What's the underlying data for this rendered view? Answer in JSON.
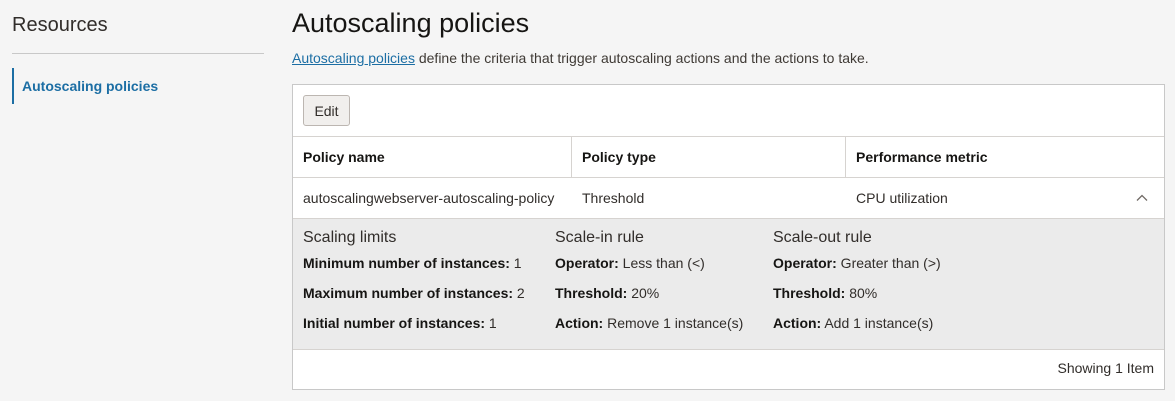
{
  "sidebar": {
    "title": "Resources",
    "items": [
      {
        "label": "Autoscaling policies"
      }
    ]
  },
  "page": {
    "title": "Autoscaling policies",
    "description_link": "Autoscaling policies",
    "description_rest": " define the criteria that trigger autoscaling actions and the actions to take."
  },
  "toolbar": {
    "edit_label": "Edit"
  },
  "table": {
    "headers": [
      "Policy name",
      "Policy type",
      "Performance metric"
    ],
    "rows": [
      {
        "policy_name": "autoscalingwebserver-autoscaling-policy",
        "policy_type": "Threshold",
        "performance_metric": "CPU utilization",
        "expanded_icon": "chevron-up-icon"
      }
    ],
    "footer": "Showing 1 Item"
  },
  "details": {
    "scaling_limits": {
      "title": "Scaling limits",
      "min_label": "Minimum number of instances:",
      "min_value": " 1",
      "max_label": "Maximum number of instances:",
      "max_value": " 2",
      "initial_label": "Initial number of instances:",
      "initial_value": " 1"
    },
    "scale_in": {
      "title": "Scale-in rule",
      "operator_label": "Operator:",
      "operator_value": " Less than (<)",
      "threshold_label": "Threshold:",
      "threshold_value": " 20%",
      "action_label": "Action:",
      "action_value": " Remove 1 instance(s)"
    },
    "scale_out": {
      "title": "Scale-out rule",
      "operator_label": "Operator:",
      "operator_value": " Greater than (>)",
      "threshold_label": "Threshold:",
      "threshold_value": " 80%",
      "action_label": "Action:",
      "action_value": " Add 1 instance(s)"
    }
  },
  "colors": {
    "accent": "#1c6ea4",
    "background": "#f5f5f5",
    "details_bg": "#ebebeb"
  }
}
